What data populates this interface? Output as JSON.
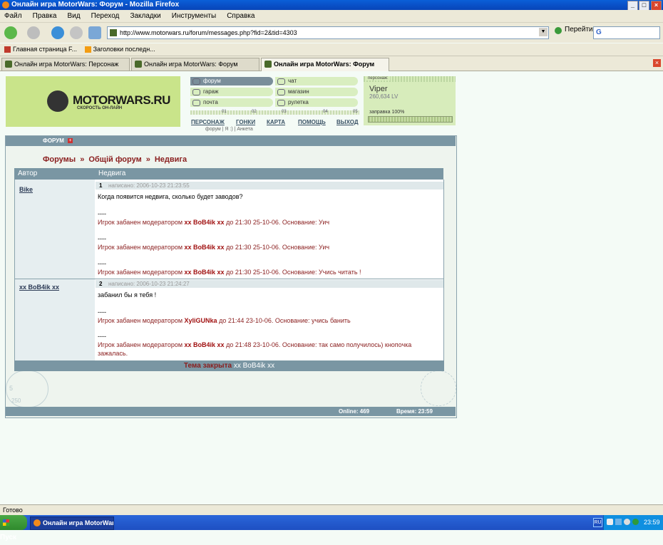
{
  "window": {
    "title": "Онлайн игра MotorWars: Форум - Mozilla Firefox"
  },
  "menu": [
    "Файл",
    "Правка",
    "Вид",
    "Переход",
    "Закладки",
    "Инструменты",
    "Справка"
  ],
  "nav": {
    "url": "http://www.motorwars.ru/forum/messages.php?fid=2&tid=4303",
    "go_label": "Перейти"
  },
  "bookmarks": [
    "Главная страница F...",
    "Заголовки последн..."
  ],
  "tabs": [
    "Онлайн игра MotorWars: Персонаж",
    "Онлайн игра MotorWars: Форум",
    "Онлайн игра MotorWars: Форум"
  ],
  "site": {
    "logo_name": "MOTORWARS.RU",
    "logo_tagline": "СКОРОСТЬ ОН-ЛАЙН",
    "menu_left": [
      "форум",
      "гараж",
      "почта"
    ],
    "menu_right": [
      "чат",
      "магазин",
      "рулетка"
    ],
    "ruler_marks": [
      "01",
      "02",
      "03",
      "04",
      "05"
    ],
    "links": [
      "ПЕРСОНАЖ",
      "ГОНКИ",
      "КАРТА",
      "ПОМОЩЬ",
      "ВЫХОД"
    ],
    "sublinks": "форум | Я :) | Анкета"
  },
  "player": {
    "label": "персонаж:",
    "name": "Viper",
    "lv": "260,634 LV",
    "fuel_label": "заправка 100%",
    "fuel_fraction": 1.0
  },
  "forum": {
    "section_label": "ФОРУМ",
    "plus": "+",
    "crumbs": [
      "Форумы",
      "Общiй форум",
      "Недвига"
    ],
    "crumb_sep": "»",
    "col_author": "Автор",
    "col_topic": "Недвига",
    "posts": [
      {
        "author": "Bike",
        "num": "1",
        "date": "написано: 2006-10-23 21:23:55",
        "text": "Когда появится недвига, сколько будет заводов?",
        "bans": [
          {
            "sep": "----",
            "pre": "Игрок забанен модератором ",
            "mod": "xx BoB4ik xx",
            "post": " до 21:30 25-10-06. Основание: Уич"
          },
          {
            "sep": "----",
            "pre": "Игрок забанен модератором ",
            "mod": "xx BoB4ik xx",
            "post": " до 21:30 25-10-06. Основание: Уич"
          },
          {
            "sep": "----",
            "pre": "Игрок забанен модератором ",
            "mod": "xx BoB4ik xx",
            "post": " до 21:30 25-10-06. Основание: Учись читать !"
          }
        ]
      },
      {
        "author": "xx BoB4ik xx",
        "num": "2",
        "date": "написано: 2006-10-23 21:24:27",
        "text": "забанил бы я тебя !",
        "bans": [
          {
            "sep": "----",
            "pre": "Игрок забанен модератором ",
            "mod": "XyliGUNka",
            "post": " до 21:44 23-10-06. Основание: учись банить"
          },
          {
            "sep": "----",
            "pre": "Игрок забанен модератором ",
            "mod": "xx BoB4ik xx",
            "post": " до 21:48 23-10-06. Основание: так само получилось) кнопочка зажалась."
          }
        ]
      }
    ],
    "closed_label": "Тема закрыта",
    "closed_by": "xx BoB4ik xx",
    "online": "Online: 469",
    "time": "Время: 23:59",
    "deco_numbers": [
      "5",
      "250"
    ]
  },
  "status": "Готово",
  "taskbar": {
    "start": "Пуск",
    "window": "Онлайн игра MotorWars...",
    "lang": "RU",
    "clock": "23:59"
  }
}
